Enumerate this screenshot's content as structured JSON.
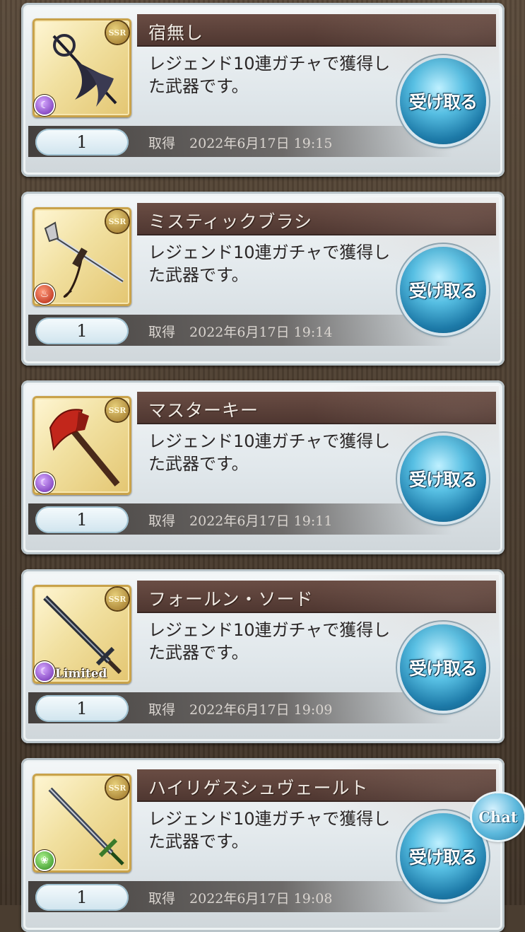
{
  "items": [
    {
      "name": "宿無し",
      "description": "レジェンド10連ガチャで獲得した武器です。",
      "quantity": "1",
      "acquired_label": "取得",
      "acquired_date": "2022年6月17日 19:15",
      "button_label": "受け取る",
      "rarity": "SSR",
      "element": "dark",
      "weapon_icon": "staff-icon",
      "limited": ""
    },
    {
      "name": "ミスティックブラシ",
      "description": "レジェンド10連ガチャで獲得した武器です。",
      "quantity": "1",
      "acquired_label": "取得",
      "acquired_date": "2022年6月17日 19:14",
      "button_label": "受け取る",
      "rarity": "SSR",
      "element": "fire",
      "weapon_icon": "brush-icon",
      "limited": ""
    },
    {
      "name": "マスターキー",
      "description": "レジェンド10連ガチャで獲得した武器です。",
      "quantity": "1",
      "acquired_label": "取得",
      "acquired_date": "2022年6月17日 19:11",
      "button_label": "受け取る",
      "rarity": "SSR",
      "element": "dark",
      "weapon_icon": "axe-icon",
      "limited": ""
    },
    {
      "name": "フォールン・ソード",
      "description": "レジェンド10連ガチャで獲得した武器です。",
      "quantity": "1",
      "acquired_label": "取得",
      "acquired_date": "2022年6月17日 19:09",
      "button_label": "受け取る",
      "rarity": "SSR",
      "element": "dark",
      "weapon_icon": "sword-icon",
      "limited": "Limited"
    },
    {
      "name": "ハイリゲスシュヴェールト",
      "description": "レジェンド10連ガチャで獲得した武器です。",
      "quantity": "1",
      "acquired_label": "取得",
      "acquired_date": "2022年6月17日 19:08",
      "button_label": "受け取る",
      "rarity": "SSR",
      "element": "wind",
      "weapon_icon": "greatsword-icon",
      "limited": ""
    }
  ],
  "chat": {
    "label": "Chat"
  },
  "colors": {
    "name_bar": "#5a3f38",
    "receive_button": "#2a8fc0",
    "frame": "#c9a24a"
  }
}
